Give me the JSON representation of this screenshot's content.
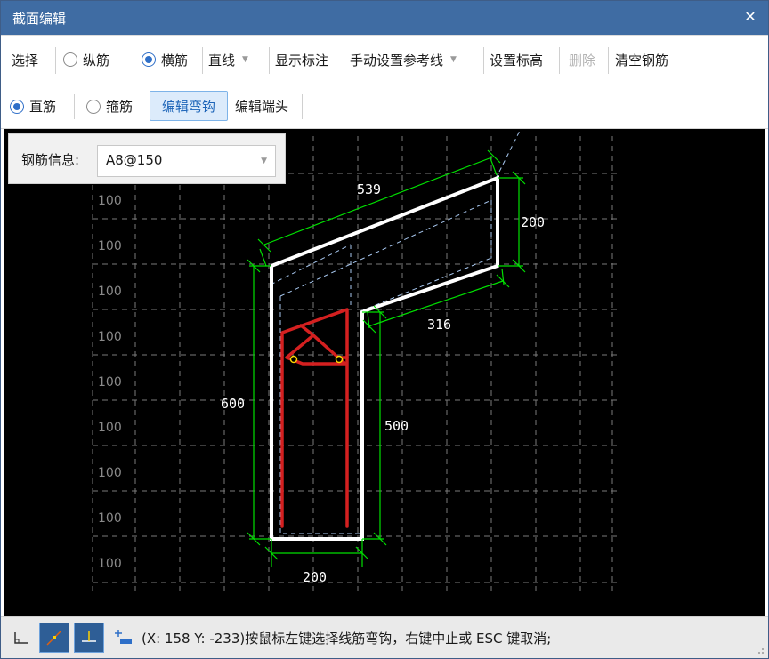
{
  "window": {
    "title": "截面编辑",
    "close_glyph": "✕"
  },
  "toolbar1": {
    "select": "选择",
    "radio_long": "纵筋",
    "radio_transverse": "横筋",
    "line_type": "直线",
    "show_annotation": "显示标注",
    "manual_ref_line": "手动设置参考线",
    "set_elevation": "设置标高",
    "delete": "删除",
    "clear_rebar": "清空钢筋"
  },
  "toolbar2": {
    "radio_straight": "直筋",
    "radio_stirrup": "箍筋",
    "edit_hook": "编辑弯钩",
    "edit_end": "编辑端头"
  },
  "rebar_info": {
    "label": "钢筋信息:",
    "value": "A8@150"
  },
  "grid_labels": [
    "100",
    "100",
    "100",
    "100",
    "100",
    "100",
    "100",
    "100",
    "100"
  ],
  "dimensions": {
    "top_slope": "539",
    "right_height": "200",
    "inner_slope": "316",
    "left_height": "600",
    "inner_height": "500",
    "bottom_width": "200"
  },
  "status": {
    "message": "(X: 158 Y: -233)按鼠标左键选择线筋弯钩，右键中止或 ESC 键取消;"
  },
  "colors": {
    "titlebar": "#3f6ca3",
    "canvas": "#000000",
    "outline": "#ffffff",
    "dimension": "#00e000",
    "rebar": "#d42020",
    "grid": "#7a7a7a"
  }
}
